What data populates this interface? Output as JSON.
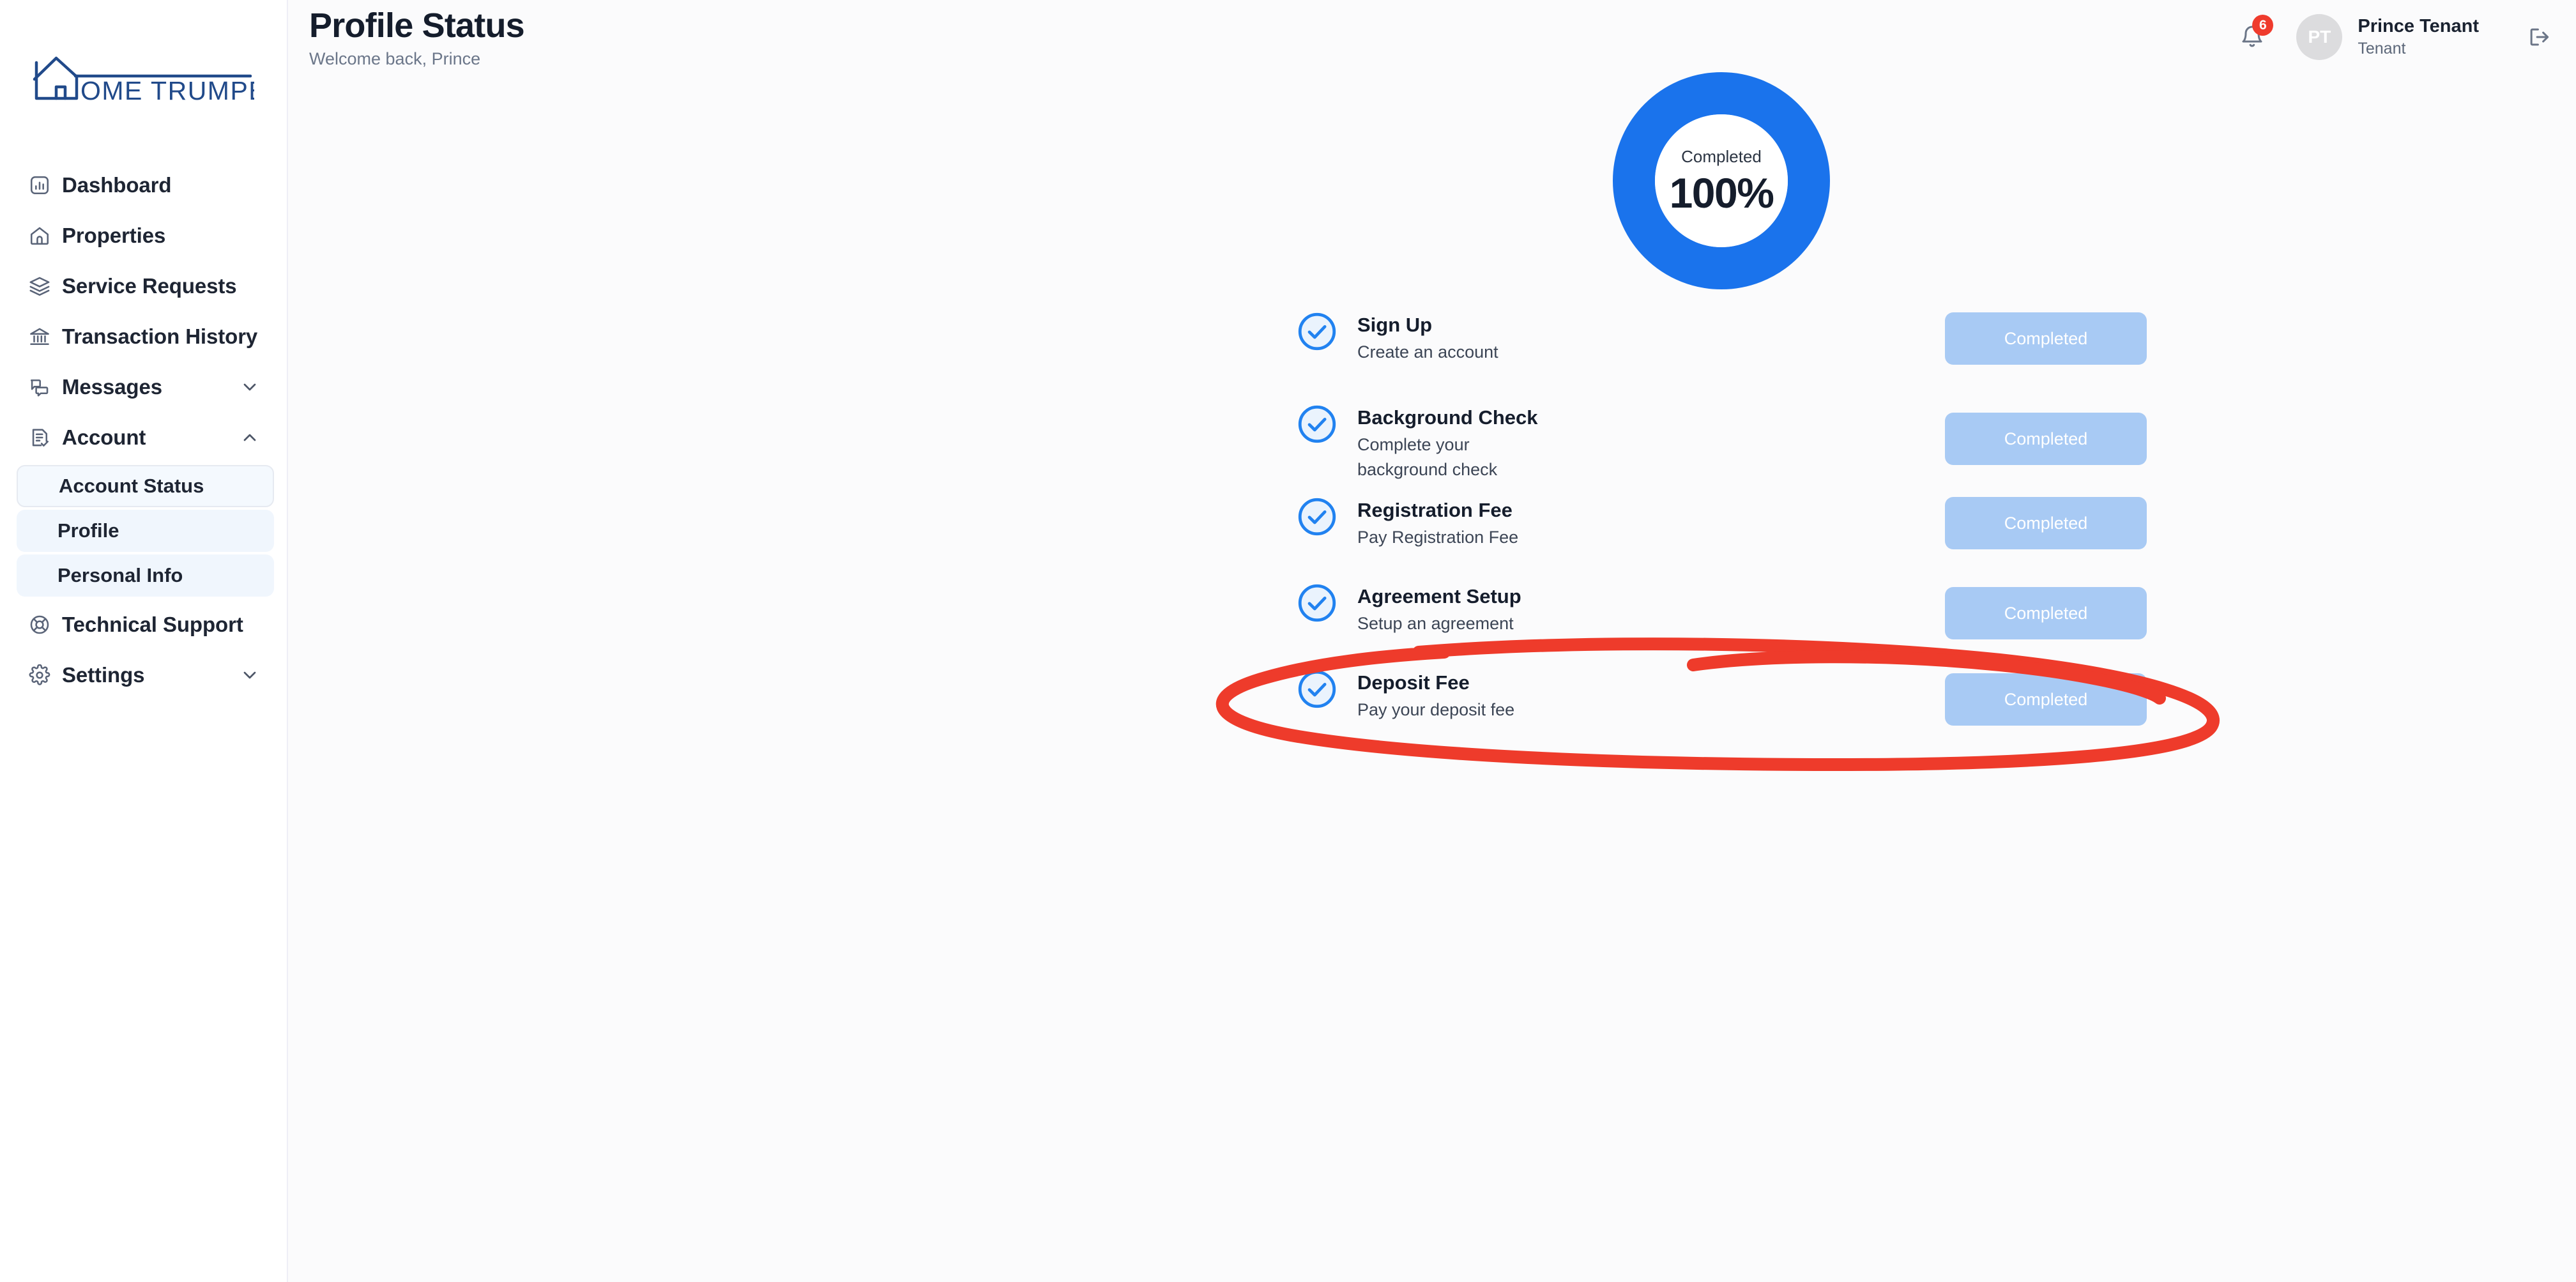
{
  "brand": {
    "logo_text": "OME TRUMPETER",
    "logo_full_name": "HOME TRUMPETER",
    "logo_color": "#214a8a"
  },
  "sidebar": {
    "items": [
      {
        "id": "dashboard",
        "label": "Dashboard",
        "icon": "bar-chart-icon",
        "expandable": false
      },
      {
        "id": "properties",
        "label": "Properties",
        "icon": "house-icon",
        "expandable": false
      },
      {
        "id": "service-requests",
        "label": "Service Requests",
        "icon": "layers-icon",
        "expandable": false
      },
      {
        "id": "transaction-history",
        "label": "Transaction History",
        "icon": "bank-icon",
        "expandable": false
      },
      {
        "id": "messages",
        "label": "Messages",
        "icon": "chat-bubbles-icon",
        "expandable": true,
        "expanded": false,
        "chevron": "chevron-down-icon"
      },
      {
        "id": "account",
        "label": "Account",
        "icon": "document-check-icon",
        "expandable": true,
        "expanded": true,
        "chevron": "chevron-up-icon"
      }
    ],
    "account_subitems": [
      {
        "id": "account-status",
        "label": "Account Status",
        "active": true
      },
      {
        "id": "profile",
        "label": "Profile",
        "active": false
      },
      {
        "id": "personal-info",
        "label": "Personal Info",
        "active": false
      }
    ],
    "bottom_items": [
      {
        "id": "technical-support",
        "label": "Technical Support",
        "icon": "lifebuoy-icon",
        "expandable": false
      },
      {
        "id": "settings",
        "label": "Settings",
        "icon": "gear-icon",
        "expandable": true,
        "expanded": false,
        "chevron": "chevron-down-icon"
      }
    ]
  },
  "header": {
    "title": "Profile Status",
    "subtitle": "Welcome back, Prince",
    "notifications": {
      "icon": "bell-icon",
      "count": "6",
      "badge_color": "#ef3b2d"
    },
    "user": {
      "avatar_initials": "PT",
      "name": "Prince Tenant",
      "role": "Tenant"
    },
    "logout_icon": "logout-icon"
  },
  "progress": {
    "label": "Completed",
    "value": "100%",
    "percent": 100,
    "ring_color": "#1a73ec",
    "track_color": "#1a73ec"
  },
  "checklist": {
    "button_label_completed": "Completed",
    "steps": [
      {
        "id": "sign-up",
        "title": "Sign Up",
        "description": "Create an account",
        "status": "Completed",
        "icon": "check-circle-icon"
      },
      {
        "id": "background-check",
        "title": "Background Check",
        "description": "Complete your background check",
        "status": "Completed",
        "icon": "check-circle-icon"
      },
      {
        "id": "registration-fee",
        "title": "Registration Fee",
        "description": "Pay Registration Fee",
        "status": "Completed",
        "icon": "check-circle-icon"
      },
      {
        "id": "agreement-setup",
        "title": "Agreement Setup",
        "description": "Setup an agreement",
        "status": "Completed",
        "icon": "check-circle-icon"
      },
      {
        "id": "deposit-fee",
        "title": "Deposit Fee",
        "description": "Pay your deposit fee",
        "status": "Completed",
        "icon": "check-circle-icon"
      }
    ]
  },
  "annotation": {
    "type": "hand-drawn-ellipse",
    "color": "#ee3b2b",
    "targets": "deposit-fee"
  },
  "colors": {
    "accent_blue": "#1a73ec",
    "button_blue": "#a8caf4",
    "sidebar_bg": "#ffffff",
    "main_bg": "#fbfbfc",
    "subitem_bg": "#f0f6fd",
    "text_dark": "#151d2c",
    "text_muted": "#6b7689"
  }
}
